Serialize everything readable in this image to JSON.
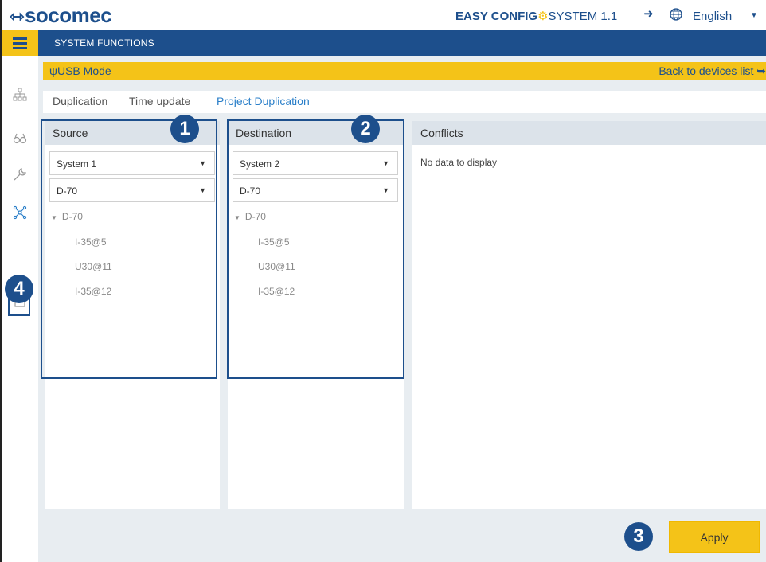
{
  "header": {
    "logo": "socomec",
    "app_name_bold": "EASY CONFIG",
    "app_name_rest": "SYSTEM 1.1",
    "language": "English"
  },
  "nav": {
    "title": "SYSTEM FUNCTIONS"
  },
  "mode_bar": {
    "label": "USB Mode",
    "back_link": "Back to devices list"
  },
  "tabs": [
    {
      "label": "Duplication",
      "active": false
    },
    {
      "label": "Time update",
      "active": false
    },
    {
      "label": "Project Duplication",
      "active": true
    }
  ],
  "source": {
    "title": "Source",
    "system_select": "System 1",
    "device_select": "D-70",
    "tree_root": "D-70",
    "tree_children": [
      "I-35@5",
      "U30@11",
      "I-35@12"
    ]
  },
  "destination": {
    "title": "Destination",
    "system_select": "System 2",
    "device_select": "D-70",
    "tree_root": "D-70",
    "tree_children": [
      "I-35@5",
      "U30@11",
      "I-35@12"
    ]
  },
  "conflicts": {
    "title": "Conflicts",
    "empty_text": "No data to display"
  },
  "apply_button": "Apply",
  "callouts": [
    "1",
    "2",
    "3",
    "4"
  ],
  "colors": {
    "brand_blue": "#1d4f8c",
    "accent_yellow": "#f4c318",
    "active_tab": "#2a7fc9",
    "background": "#e8edf1"
  },
  "icons": {
    "sidebar": [
      "network-icon",
      "binoculars-icon",
      "wrench-icon",
      "connections-icon",
      "export-icon"
    ]
  }
}
